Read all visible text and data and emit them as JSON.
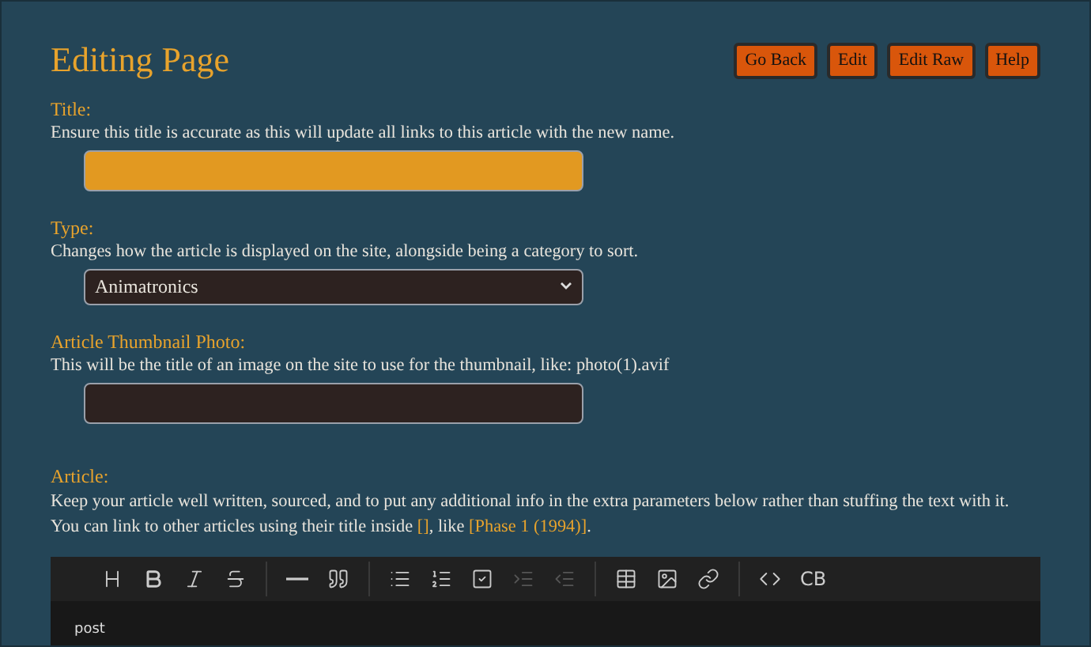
{
  "heading": "Editing Page",
  "buttons": [
    "Go Back",
    "Edit",
    "Edit Raw",
    "Help"
  ],
  "fields": [
    {
      "kind": "text",
      "label": "Title:",
      "help": "Ensure this title is accurate as this will update all links to this article with the new name.",
      "highlighted": true
    },
    {
      "kind": "select",
      "label": "Type:",
      "help": "Changes how the article is displayed on the site, alongside being a category to sort.",
      "value": "Animatronics",
      "highlighted": false
    },
    {
      "kind": "text",
      "label": "Article Thumbnail Photo:",
      "help": "This will be the title of an image on the site to use for the thumbnail, like: photo(1).avif",
      "highlighted": false
    }
  ],
  "article": {
    "label": "Article:",
    "help": [
      {
        "kind": "text",
        "text": "Keep your article well written, sourced, and to put any additional info in the extra parameters below rather than stuffing the text with it. You can link to other articles using their title inside "
      },
      {
        "kind": "link",
        "text": "[]"
      },
      {
        "kind": "text",
        "text": ", like "
      },
      {
        "kind": "link",
        "text": "[Phase 1 (1994)]"
      },
      {
        "kind": "text",
        "text": "."
      }
    ],
    "toolbar": [
      [
        {
          "kind": "heading",
          "disabled": false
        },
        {
          "kind": "bold",
          "disabled": false
        },
        {
          "kind": "italic",
          "disabled": false
        },
        {
          "kind": "strike",
          "disabled": false
        }
      ],
      [
        {
          "kind": "rule",
          "disabled": false
        },
        {
          "kind": "quote",
          "disabled": false
        }
      ],
      [
        {
          "kind": "bullets",
          "disabled": false
        },
        {
          "kind": "numbers",
          "disabled": false
        },
        {
          "kind": "checklist",
          "disabled": false
        },
        {
          "kind": "indent",
          "disabled": true
        },
        {
          "kind": "outdent",
          "disabled": true
        }
      ],
      [
        {
          "kind": "table",
          "disabled": false
        },
        {
          "kind": "image",
          "disabled": false
        },
        {
          "kind": "link",
          "disabled": false
        }
      ],
      [
        {
          "kind": "code",
          "disabled": false
        },
        {
          "kind": "textbutton",
          "label": "CB",
          "disabled": false
        }
      ]
    ],
    "content": "post"
  }
}
